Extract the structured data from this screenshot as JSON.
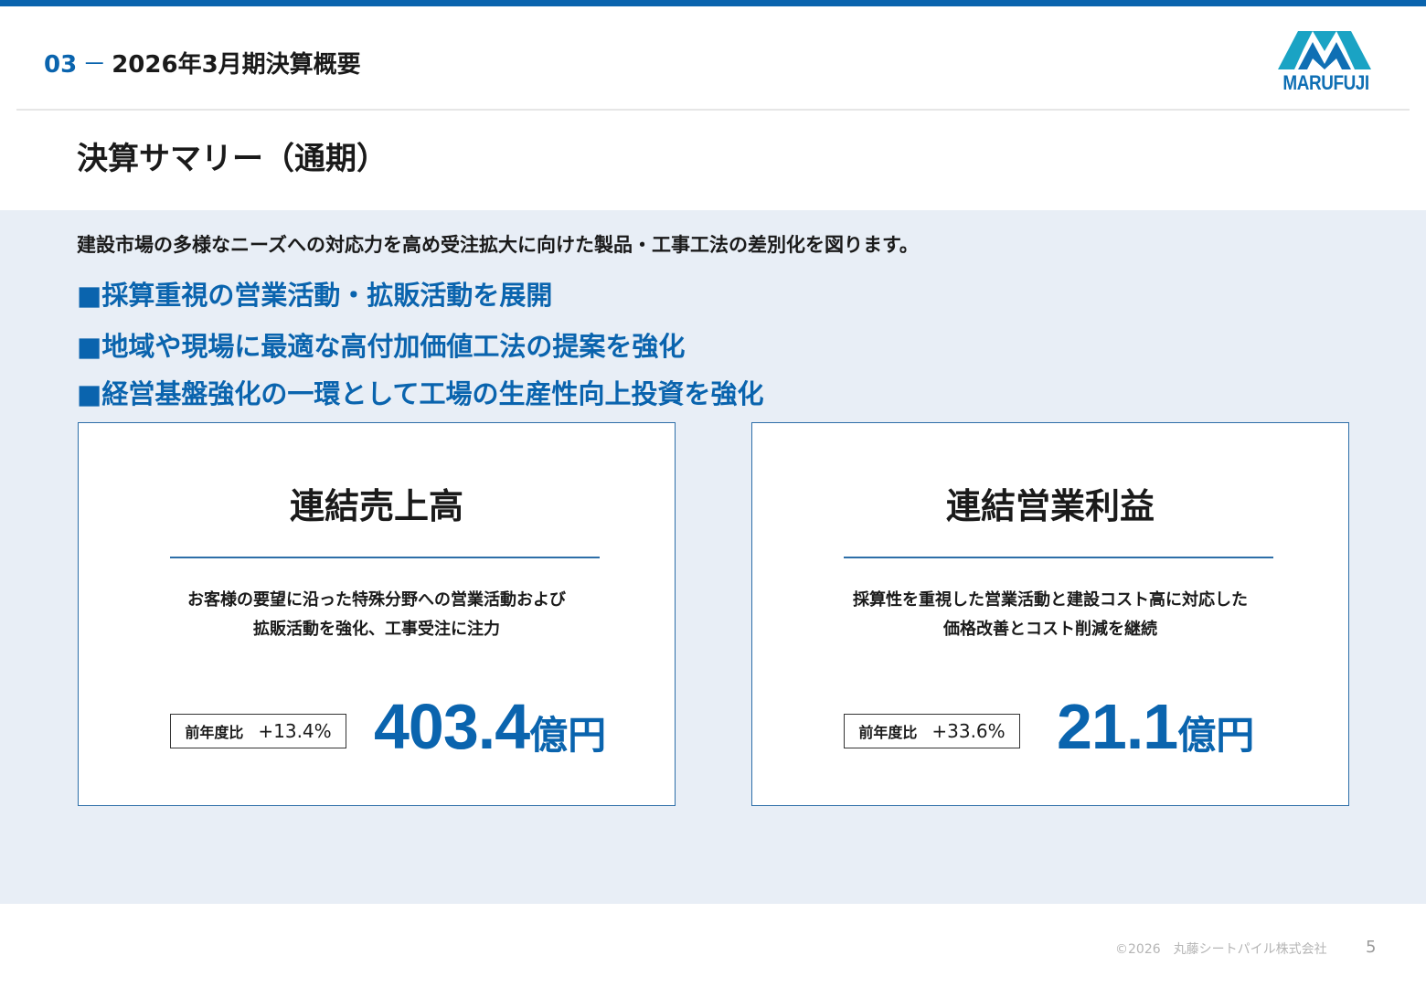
{
  "header": {
    "section_number": "03",
    "section_dash": "－",
    "section_title": "2026年3月期決算概要",
    "logo_text": "MARUFUJI"
  },
  "page_title": "決算サマリー（通期）",
  "intro": "建設市場の多様なニーズへの対応力を高め受注拡大に向けた製品・工事工法の差別化を図ります。",
  "bullets": [
    "■採算重視の営業活動・拡販活動を展開",
    "■地域や現場に最適な高付加価値工法の提案を強化",
    "■経営基盤強化の一環として工場の生産性向上投資を強化"
  ],
  "cards": [
    {
      "title": "連結売上高",
      "desc_lines": [
        "お客様の要望に沿った特殊分野への営業活動および",
        "拡販活動を強化、工事受注に注力"
      ],
      "yoy_label": "前年度比",
      "yoy_value": "+13.4%",
      "value": "403.4",
      "unit": "億円"
    },
    {
      "title": "連結営業利益",
      "desc_lines": [
        "採算性を重視した営業活動と建設コスト高に対応した",
        "価格改善とコスト削減を継続"
      ],
      "yoy_label": "前年度比",
      "yoy_value": "+33.6%",
      "value": "21.1",
      "unit": "億円"
    }
  ],
  "footer": {
    "copyright": "©2026　丸藤シートパイル株式会社",
    "page_number": "5"
  },
  "colors": {
    "accent": "#0a64ae",
    "logo": "#0f6fb4",
    "logo_cyan": "#1aa3c4",
    "content_bg": "#e8eef6"
  }
}
